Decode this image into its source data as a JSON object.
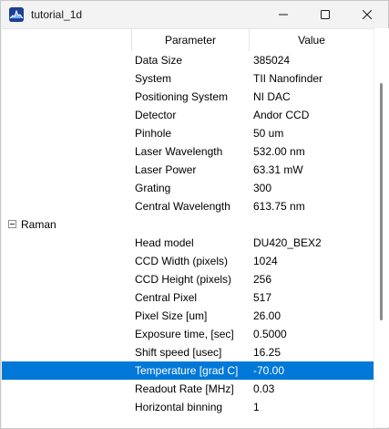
{
  "window": {
    "title": "tutorial_1d"
  },
  "icons": {
    "app": "app-logo-icon",
    "minimize": "minimize-icon",
    "maximize": "maximize-icon",
    "close": "close-icon",
    "expander": "collapse-icon"
  },
  "colors": {
    "selection": "#0078d7",
    "selection_text": "#ffffff"
  },
  "table": {
    "headers": {
      "parameter": "Parameter",
      "value": "Value"
    },
    "rows": [
      {
        "param": "Data Size",
        "value": "385024"
      },
      {
        "param": "System",
        "value": "TII Nanofinder"
      },
      {
        "param": "Positioning System",
        "value": "NI DAC"
      },
      {
        "param": "Detector",
        "value": "Andor CCD"
      },
      {
        "param": "Pinhole",
        "value": "50 um"
      },
      {
        "param": "Laser Wavelength",
        "value": "532.00 nm"
      },
      {
        "param": "Laser Power",
        "value": "63.31 mW"
      },
      {
        "param": "Grating",
        "value": "300"
      },
      {
        "param": "Central Wavelength",
        "value": "613.75 nm"
      }
    ],
    "group": {
      "label": "Raman",
      "expanded": true
    },
    "group_rows": [
      {
        "param": "Head model",
        "value": "DU420_BEX2"
      },
      {
        "param": "CCD Width (pixels)",
        "value": "1024"
      },
      {
        "param": "CCD Height (pixels)",
        "value": "256"
      },
      {
        "param": "Central Pixel",
        "value": "517"
      },
      {
        "param": "Pixel Size [um]",
        "value": "26.00"
      },
      {
        "param": "Exposure time, [sec]",
        "value": "0.5000"
      },
      {
        "param": "Shift speed [usec]",
        "value": "16.25"
      },
      {
        "param": "Temperature [grad C]",
        "value": "-70.00",
        "selected": true
      },
      {
        "param": "Readout Rate [MHz]",
        "value": "0.03"
      },
      {
        "param": "Horizontal binning",
        "value": "1"
      }
    ]
  }
}
